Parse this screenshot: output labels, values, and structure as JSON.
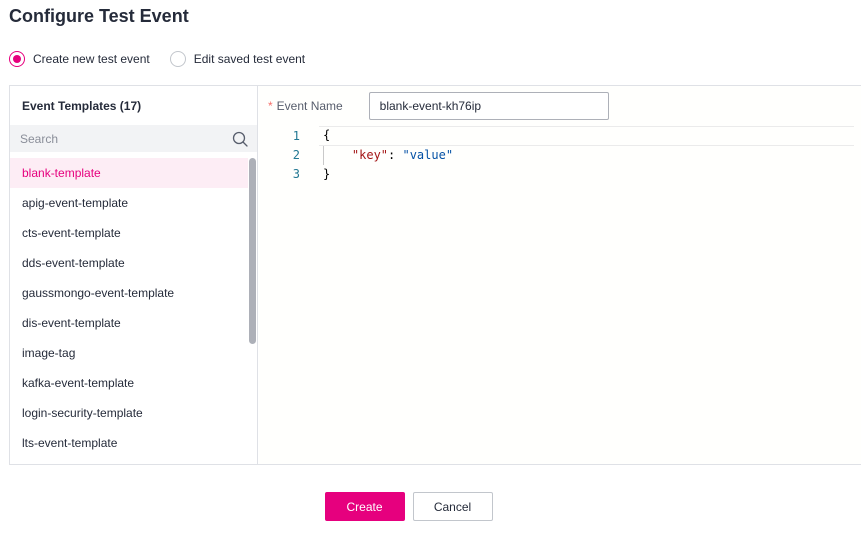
{
  "dialog": {
    "title": "Configure Test Event"
  },
  "mode": {
    "options": [
      {
        "label": "Create new test event",
        "checked": true
      },
      {
        "label": "Edit saved test event",
        "checked": false
      }
    ]
  },
  "templates": {
    "title": "Event Templates (17)",
    "search_placeholder": "Search",
    "search_value": "",
    "selected": "blank-template",
    "items": [
      "blank-template",
      "apig-event-template",
      "cts-event-template",
      "dds-event-template",
      "gaussmongo-event-template",
      "dis-event-template",
      "image-tag",
      "kafka-event-template",
      "login-security-template",
      "lts-event-template"
    ]
  },
  "form": {
    "required_mark": "*",
    "event_name_label": "Event Name",
    "event_name_value": "blank-event-kh76ip"
  },
  "editor": {
    "lines": [
      {
        "no": "1",
        "text": "{"
      },
      {
        "no": "2",
        "key": "\"key\"",
        "sep": ": ",
        "value": "\"value\""
      },
      {
        "no": "3",
        "text": "}"
      }
    ]
  },
  "footer": {
    "create_label": "Create",
    "cancel_label": "Cancel"
  },
  "colors": {
    "accent": "#e6007e",
    "selected_bg": "#fdedf5",
    "required": "#f66f6a",
    "json_key": "#a31515",
    "json_string": "#0451a5",
    "line_number": "#237893"
  }
}
